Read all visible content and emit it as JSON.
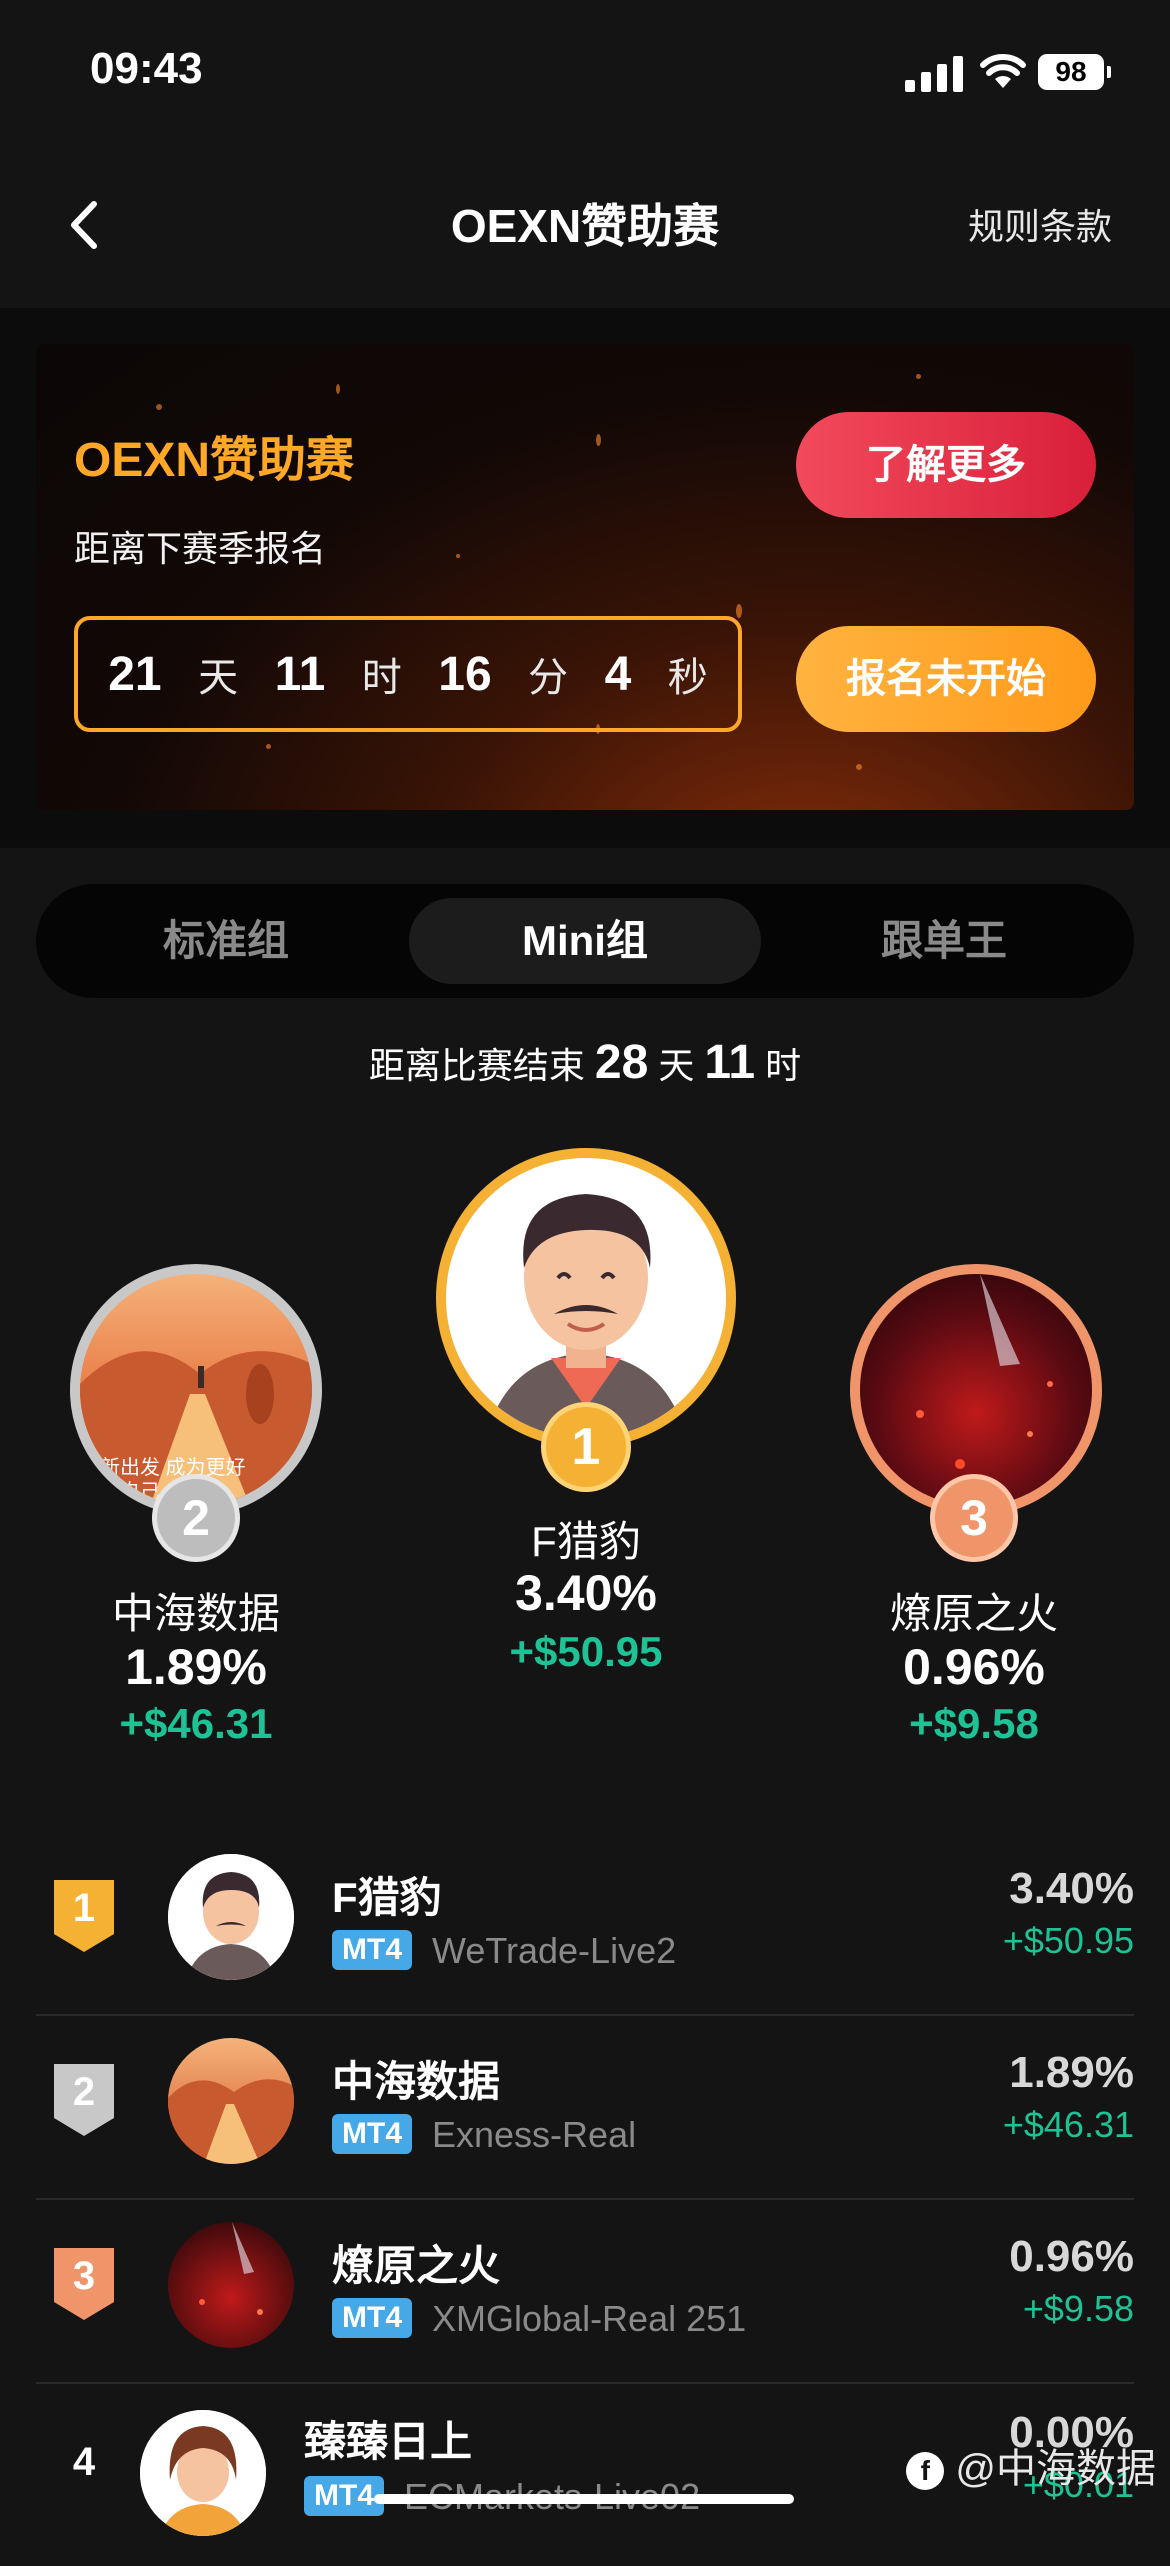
{
  "status_bar": {
    "time": "09:43",
    "battery": "98"
  },
  "nav": {
    "title": "OEXN赞助赛",
    "rules": "规则条款"
  },
  "banner": {
    "title": "OEXN赞助赛",
    "subtitle": "距离下赛季报名",
    "countdown": [
      {
        "value": "21",
        "unit": "天"
      },
      {
        "value": "11",
        "unit": "时"
      },
      {
        "value": "16",
        "unit": "分"
      },
      {
        "value": "4",
        "unit": "秒"
      }
    ],
    "learn_more": "了解更多",
    "signup": "报名未开始"
  },
  "tabs": [
    {
      "label": "标准组"
    },
    {
      "label": "Mini组"
    },
    {
      "label": "跟单王"
    }
  ],
  "ends": {
    "prefix": "距离比赛结束",
    "days": "28",
    "day_unit": "天",
    "hours": "11",
    "hour_unit": "时"
  },
  "podium": {
    "first": {
      "rank": "1",
      "name": "F猎豹",
      "pct": "3.40%",
      "profit": "+$50.95"
    },
    "second": {
      "rank": "2",
      "name": "中海数据",
      "pct": "1.89%",
      "profit": "+$46.31",
      "avatar_text": "新出发 成为更好的自己"
    },
    "third": {
      "rank": "3",
      "name": "燎原之火",
      "pct": "0.96%",
      "profit": "+$9.58"
    }
  },
  "leaderboard": [
    {
      "rank": "1",
      "name": "F猎豹",
      "platform": "MT4",
      "server": "WeTrade-Live2",
      "pct": "3.40%",
      "profit": "+$50.95"
    },
    {
      "rank": "2",
      "name": "中海数据",
      "platform": "MT4",
      "server": "Exness-Real",
      "pct": "1.89%",
      "profit": "+$46.31"
    },
    {
      "rank": "3",
      "name": "燎原之火",
      "platform": "MT4",
      "server": "XMGlobal-Real 251",
      "pct": "0.96%",
      "profit": "+$9.58"
    },
    {
      "rank": "4",
      "name": "臻臻日上",
      "platform": "MT4",
      "server": "ECMarkets-Live02",
      "pct": "0.00%",
      "profit": "+$0.01"
    }
  ],
  "watermark": "@中海数据",
  "colors": {
    "accent_orange": "#ffa726",
    "accent_red": "#e3293f",
    "profit_green": "#1fc295",
    "gold": "#f5b133",
    "silver": "#c8c8c8",
    "bronze": "#f0946a"
  }
}
